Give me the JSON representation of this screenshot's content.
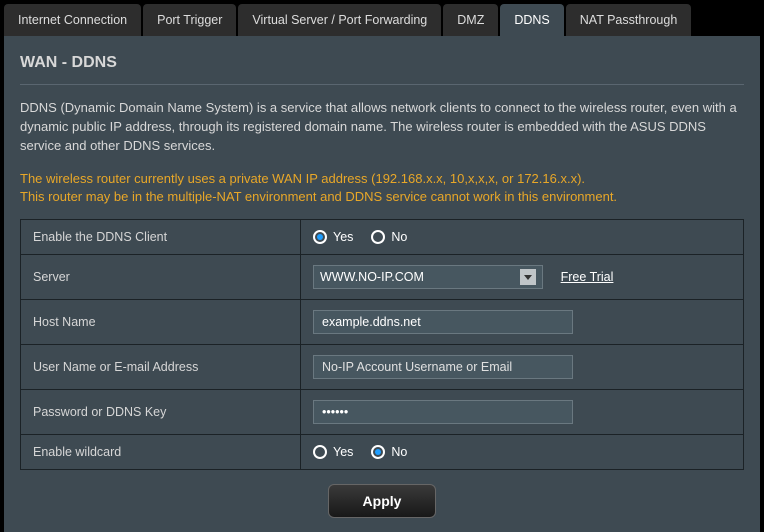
{
  "tabs": {
    "internet": "Internet Connection",
    "port_trigger": "Port Trigger",
    "port_forward": "Virtual Server / Port Forwarding",
    "dmz": "DMZ",
    "ddns": "DDNS",
    "nat": "NAT Passthrough"
  },
  "page": {
    "title": "WAN - DDNS",
    "description": "DDNS (Dynamic Domain Name System) is a service that allows network clients to connect to the wireless router, even with a dynamic public IP address, through its registered domain name. The wireless router is embedded with the ASUS DDNS service and other DDNS services.",
    "warning_line1": "The wireless router currently uses a private WAN IP address (192.168.x.x, 10,x,x,x, or 172.16.x.x).",
    "warning_line2": "This router may be in the multiple-NAT environment and DDNS service cannot work in this environment."
  },
  "form": {
    "enable_label": "Enable the DDNS Client",
    "enable_value": "Yes",
    "server_label": "Server",
    "server_value": "WWW.NO-IP.COM",
    "free_trial": "Free Trial",
    "hostname_label": "Host Name",
    "hostname_value": "example.ddns.net",
    "username_label": "User Name or E-mail Address",
    "username_placeholder": "No-IP Account Username or Email",
    "password_label": "Password or DDNS Key",
    "password_value": "••••••",
    "wildcard_label": "Enable wildcard",
    "wildcard_value": "No",
    "yes": "Yes",
    "no": "No",
    "apply": "Apply"
  }
}
